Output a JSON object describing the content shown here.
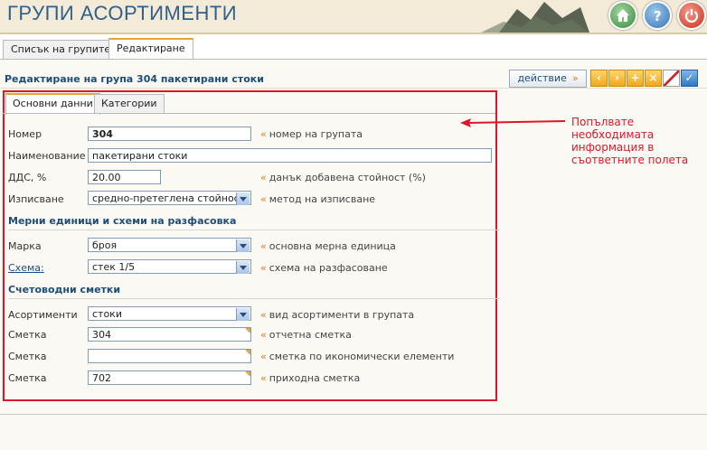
{
  "header": {
    "title": "ГРУПИ АСОРТИМЕНТИ",
    "buttons": [
      "home-icon",
      "help-icon",
      "power-icon"
    ]
  },
  "top_tabs": [
    {
      "label": "Списък на групите",
      "active": false
    },
    {
      "label": "Редактиране",
      "active": true
    }
  ],
  "page": {
    "title": "Редактиране на група 304 пакетирани стоки",
    "action_label": "действие",
    "action_arrow": "»",
    "toolbar": [
      "prev-icon",
      "next-icon",
      "add-icon",
      "delete-icon",
      "clear-icon",
      "save-icon"
    ]
  },
  "inner_tabs": [
    {
      "label": "Основни данни",
      "active": true
    },
    {
      "label": "Категории",
      "active": false
    }
  ],
  "fields": {
    "number": {
      "label": "Номер",
      "value": "304",
      "hint": "номер на групата"
    },
    "name": {
      "label": "Наименование",
      "value": "пакетирани стоки"
    },
    "vat": {
      "label": "ДДС, %",
      "value": "20.00",
      "hint": "данък добавена стойност (%)"
    },
    "writeoff": {
      "label": "Изписване",
      "value": "средно-претеглена стойност",
      "hint": "метод на изписване"
    }
  },
  "sections": {
    "units": "Мерни единици и схеми на разфасовка",
    "accounts": "Счетоводни сметки"
  },
  "units": {
    "brand": {
      "label": "Марка",
      "value": "броя",
      "hint": "основна мерна единица"
    },
    "scheme": {
      "label": "Схема:",
      "value": "стек 1/5",
      "hint": "схема на разфасоване"
    }
  },
  "accounts": {
    "assortments": {
      "label": "Асортименти",
      "value": "стоки",
      "hint": "вид асортименти в групата"
    },
    "account1": {
      "label": "Сметка",
      "value": "304",
      "hint": "отчетна сметка"
    },
    "account2": {
      "label": "Сметка",
      "value": "",
      "hint": "сметка по икономически елементи"
    },
    "account3": {
      "label": "Сметка",
      "value": "702",
      "hint": "приходна сметка"
    }
  },
  "annotation": {
    "text": "Попълвате необходимата информация в съответните полета",
    "color": "#e0152b"
  },
  "hint_marker": "«"
}
